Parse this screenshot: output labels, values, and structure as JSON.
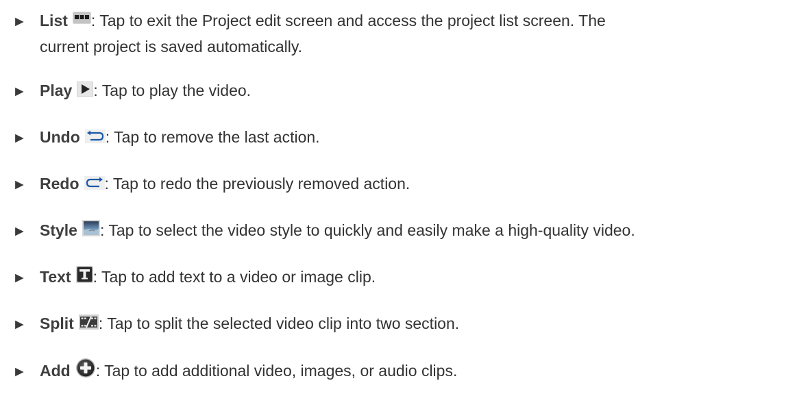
{
  "bullet_glyph": "►",
  "items": [
    {
      "term": "List",
      "icon": "list-icon",
      "desc": ": Tap to exit the Project edit screen and access the project list screen. The",
      "desc2": "current project is saved automatically."
    },
    {
      "term": "Play",
      "icon": "play-icon",
      "desc": ": Tap to play the video."
    },
    {
      "term": "Undo",
      "icon": "undo-icon",
      "desc": ": Tap to remove the last action."
    },
    {
      "term": "Redo",
      "icon": "redo-icon",
      "desc": ": Tap to redo the previously removed action."
    },
    {
      "term": "Style",
      "icon": "style-icon",
      "desc": ": Tap to select the video style to quickly and easily make a high-quality video."
    },
    {
      "term": "Text",
      "icon": "text-icon",
      "desc": ": Tap to add text to a video or image clip."
    },
    {
      "term": "Split",
      "icon": "split-icon",
      "desc": ": Tap to split the selected video clip into two section."
    },
    {
      "term": "Add",
      "icon": "add-icon",
      "desc": ": Tap to add additional video, images, or audio clips."
    }
  ]
}
